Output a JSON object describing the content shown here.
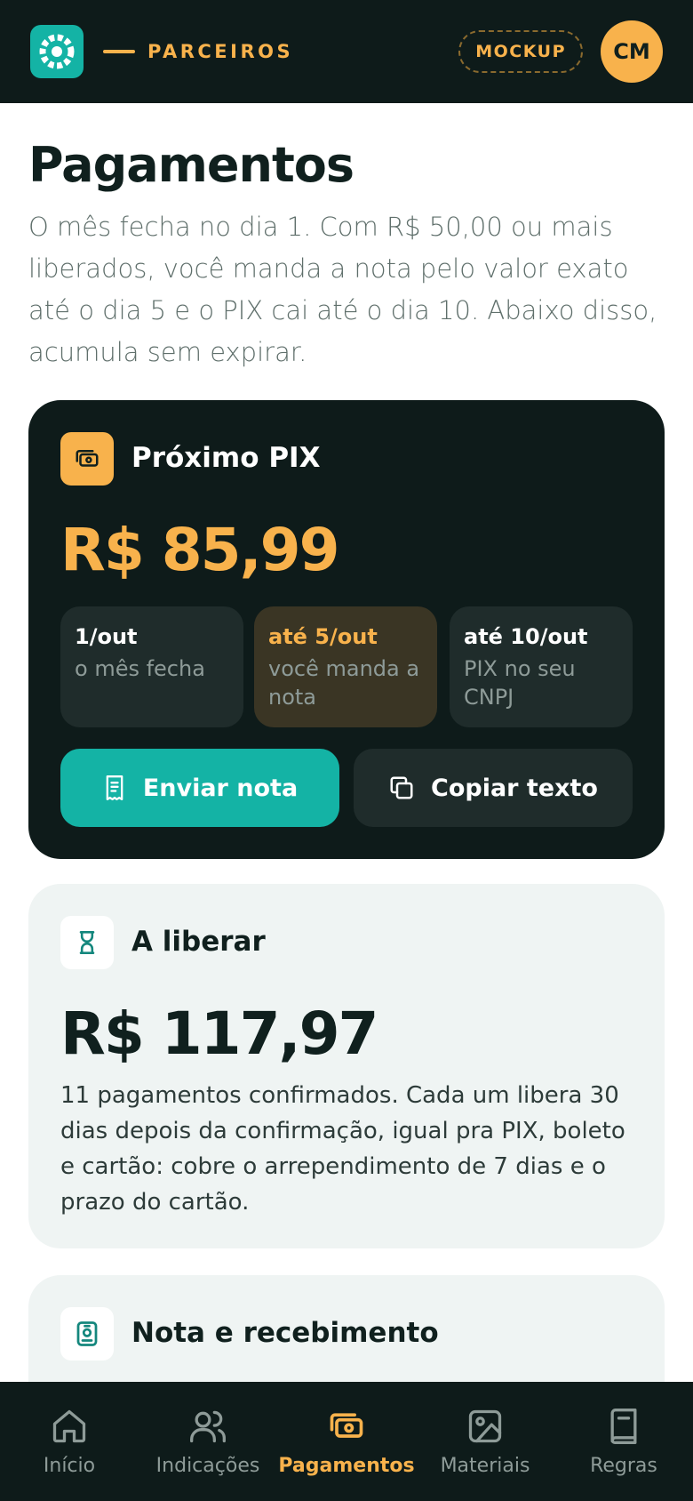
{
  "header": {
    "brand": "PARCEIROS",
    "badge": "MOCKUP",
    "avatar_initials": "CM"
  },
  "page": {
    "title": "Pagamentos",
    "description": "O mês fecha no dia 1. Com R$ 50,00 ou mais liberados, você manda a nota pelo valor exato até o dia 5 e o PIX cai até o dia 10. Abaixo disso, acumula sem expirar."
  },
  "pix_card": {
    "icon": "money-icon",
    "title": "Próximo PIX",
    "amount": "R$ 85,99",
    "steps": [
      {
        "title": "1/out",
        "subtitle": "o mês fecha"
      },
      {
        "title": "até 5/out",
        "subtitle": "você manda a nota"
      },
      {
        "title": "até 10/out",
        "subtitle": "PIX no seu CNPJ"
      }
    ],
    "primary_button": "Enviar nota",
    "secondary_button": "Copiar texto"
  },
  "release_card": {
    "icon": "hourglass-icon",
    "title": "A liberar",
    "amount": "R$ 117,97",
    "description": "11 pagamentos confirmados. Cada um libera 30 dias depois da confirmação, igual pra PIX, boleto e cartão: cobre o arrependimento de 7 dias e o prazo do cartão."
  },
  "invoice_card": {
    "icon": "id-card-icon",
    "title": "Nota e recebimento"
  },
  "nav": {
    "items": [
      {
        "label": "Início",
        "icon": "home-icon"
      },
      {
        "label": "Indicações",
        "icon": "users-icon"
      },
      {
        "label": "Pagamentos",
        "icon": "money-icon"
      },
      {
        "label": "Materiais",
        "icon": "image-icon"
      },
      {
        "label": "Regras",
        "icon": "book-icon"
      }
    ],
    "active": "Pagamentos"
  },
  "colors": {
    "accent": "#f8b24c",
    "primary": "#14b3a5",
    "dark": "#0e1b1a"
  }
}
